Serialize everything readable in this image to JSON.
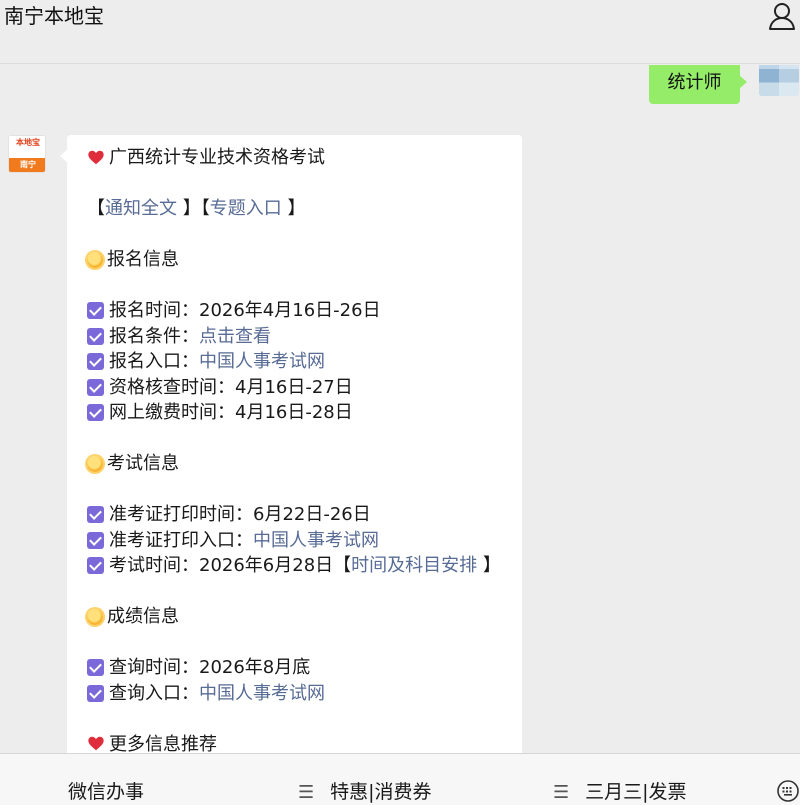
{
  "header": {
    "title": "南宁本地宝",
    "profile_icon": "person-icon"
  },
  "outgoing": {
    "text": "统计师",
    "bubble_color": "#95ec69"
  },
  "incoming": {
    "avatar": {
      "top_text": "本地宝",
      "bottom_text": "南宁"
    },
    "heading": "广西统计专业技术资格考试",
    "links": {
      "open": "【",
      "notice": "通知全文",
      "sep": " 】【",
      "topic": "专题入口",
      "close": " 】"
    },
    "sections": [
      {
        "title": "报名信息",
        "items": [
          {
            "label": "报名时间：",
            "value": "2026年4月16日-26日"
          },
          {
            "label": "报名条件：",
            "link": "点击查看"
          },
          {
            "label": "报名入口：",
            "link": "中国人事考试网"
          },
          {
            "label": "资格核查时间：",
            "value": "4月16日-27日"
          },
          {
            "label": "网上缴费时间：",
            "value": "4月16日-28日"
          }
        ]
      },
      {
        "title": "考试信息",
        "items": [
          {
            "label": "准考证打印时间：",
            "value": "6月22日-26日"
          },
          {
            "label": "准考证打印入口：",
            "link": "中国人事考试网"
          },
          {
            "label": "考试时间：",
            "value": "2026年6月28日",
            "bracket_open": "【",
            "link": "时间及科目安排",
            "bracket_close": " 】"
          }
        ]
      },
      {
        "title": "成绩信息",
        "items": [
          {
            "label": "查询时间：",
            "value": "2026年8月底"
          },
          {
            "label": "查询入口：",
            "link": "中国人事考试网"
          }
        ]
      }
    ],
    "more": "更多信息推荐",
    "link_color": "#576b95",
    "check_color": "#7b68d9"
  },
  "bottom_menu": {
    "items": [
      "微信办事",
      "特惠|消费券",
      "三月三|发票"
    ],
    "menu_icon": "hamburger-icon",
    "keyboard_icon": "keyboard-icon"
  }
}
